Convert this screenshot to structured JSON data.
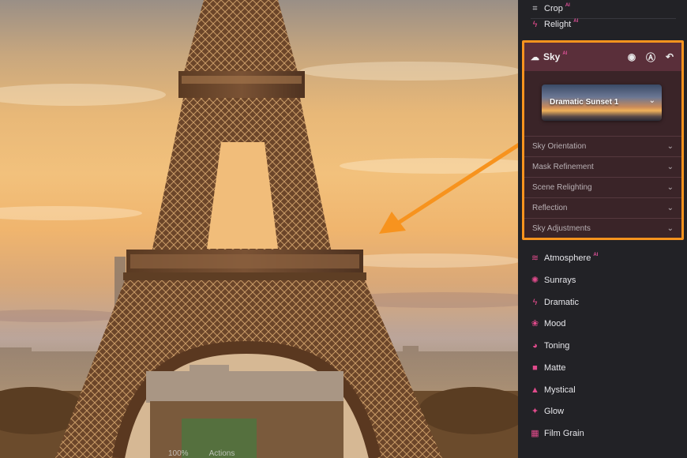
{
  "panel": {
    "top_tools": [
      {
        "label": "Crop",
        "ai": "AI",
        "icon": "crop-icon",
        "glyph": "⌗"
      },
      {
        "label": "Relight",
        "ai": "AI",
        "icon": "relight-icon",
        "glyph": "⚡"
      }
    ],
    "sky": {
      "title": "Sky",
      "ai": "AI",
      "preset": "Dramatic Sunset 1",
      "sections": [
        "Sky Orientation",
        "Mask Refinement",
        "Scene Relighting",
        "Reflection",
        "Sky Adjustments"
      ]
    },
    "filters": [
      {
        "label": "Atmosphere",
        "ai": "AI",
        "icon": "atmosphere-icon"
      },
      {
        "label": "Sunrays",
        "ai": "",
        "icon": "sunrays-icon"
      },
      {
        "label": "Dramatic",
        "ai": "",
        "icon": "dramatic-icon"
      },
      {
        "label": "Mood",
        "ai": "",
        "icon": "mood-icon"
      },
      {
        "label": "Toning",
        "ai": "",
        "icon": "toning-icon"
      },
      {
        "label": "Matte",
        "ai": "",
        "icon": "matte-icon"
      },
      {
        "label": "Mystical",
        "ai": "",
        "icon": "mystical-icon"
      },
      {
        "label": "Glow",
        "ai": "",
        "icon": "glow-icon"
      },
      {
        "label": "Film Grain",
        "ai": "",
        "icon": "film-grain-icon"
      }
    ]
  },
  "canvas": {
    "zoom": "100%",
    "actions": "Actions"
  },
  "colors": {
    "highlight": "#f7931e",
    "accent": "#e14b8c",
    "panel_bg": "#222226"
  }
}
